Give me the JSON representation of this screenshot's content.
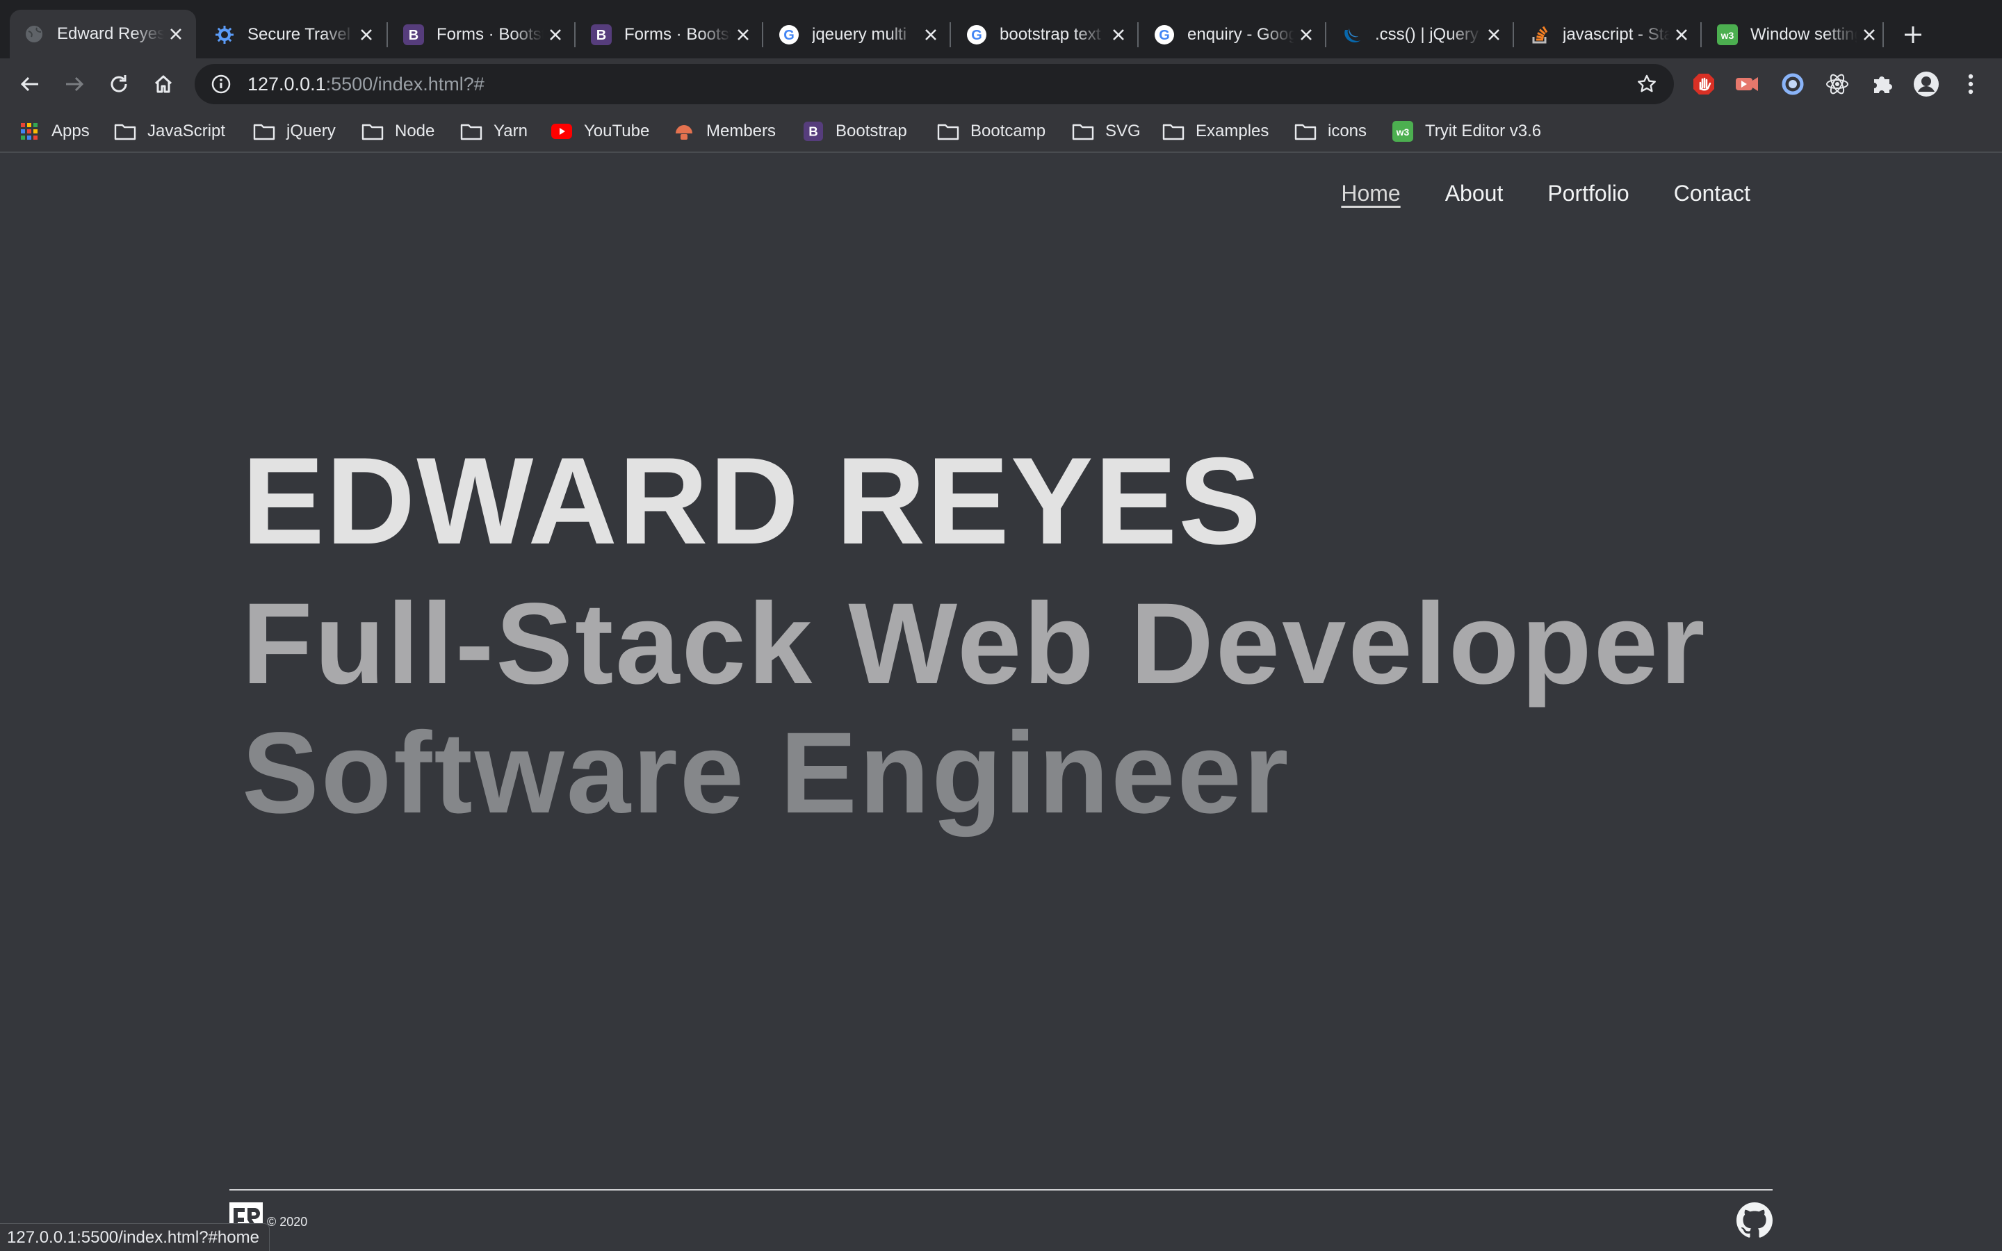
{
  "browser": {
    "tabs": [
      {
        "title": "Edward Reyes",
        "icon": "globe-icon",
        "active": true
      },
      {
        "title": "Secure Travel",
        "icon": "gear-blue-icon",
        "active": false
      },
      {
        "title": "Forms · Bootstrap",
        "icon": "bootstrap-icon",
        "active": false
      },
      {
        "title": "Forms · Bootstrap",
        "icon": "bootstrap-icon",
        "active": false
      },
      {
        "title": "jqeuery multi",
        "icon": "google-icon",
        "active": false
      },
      {
        "title": "bootstrap text",
        "icon": "google-icon",
        "active": false
      },
      {
        "title": "enquiry - Google",
        "icon": "google-icon",
        "active": false
      },
      {
        "title": ".css() | jQuery",
        "icon": "jquery-icon",
        "active": false
      },
      {
        "title": "javascript - Stack",
        "icon": "stackoverflow-icon",
        "active": false
      },
      {
        "title": "Window setting",
        "icon": "tryit-icon",
        "active": false
      }
    ],
    "address": {
      "host": "127.0.0.1",
      "rest": ":5500/index.html?#"
    },
    "bookmarks": [
      {
        "label": "Apps",
        "icon": "apps-grid-icon"
      },
      {
        "label": "JavaScript",
        "icon": "folder-icon"
      },
      {
        "label": "jQuery",
        "icon": "folder-icon"
      },
      {
        "label": "Node",
        "icon": "folder-icon"
      },
      {
        "label": "Yarn",
        "icon": "folder-icon"
      },
      {
        "label": "YouTube",
        "icon": "youtube-icon"
      },
      {
        "label": "Members",
        "icon": "members-icon"
      },
      {
        "label": "Bootstrap",
        "icon": "bootstrap-icon"
      },
      {
        "label": "Bootcamp",
        "icon": "folder-icon"
      },
      {
        "label": "SVG",
        "icon": "folder-icon"
      },
      {
        "label": "Examples",
        "icon": "folder-icon"
      },
      {
        "label": "icons",
        "icon": "folder-icon"
      },
      {
        "label": "Tryit Editor v3.6",
        "icon": "tryit-icon"
      }
    ],
    "status_url": "127.0.0.1:5500/index.html?#home"
  },
  "page": {
    "nav": {
      "home": "Home",
      "about": "About",
      "portfolio": "Portfolio",
      "contact": "Contact"
    },
    "hero": {
      "name": "EDWARD REYES",
      "role_1": "Full-Stack Web Developer",
      "role_2": "Software Engineer"
    },
    "footer": {
      "copyright": "© 2020",
      "logo": "er-logo-icon",
      "github": "github-icon"
    }
  },
  "colors": {
    "page_bg": "#35373c",
    "name": "#e2e2e2",
    "role_1": "#a9a9ab",
    "role_2": "#85878a"
  }
}
